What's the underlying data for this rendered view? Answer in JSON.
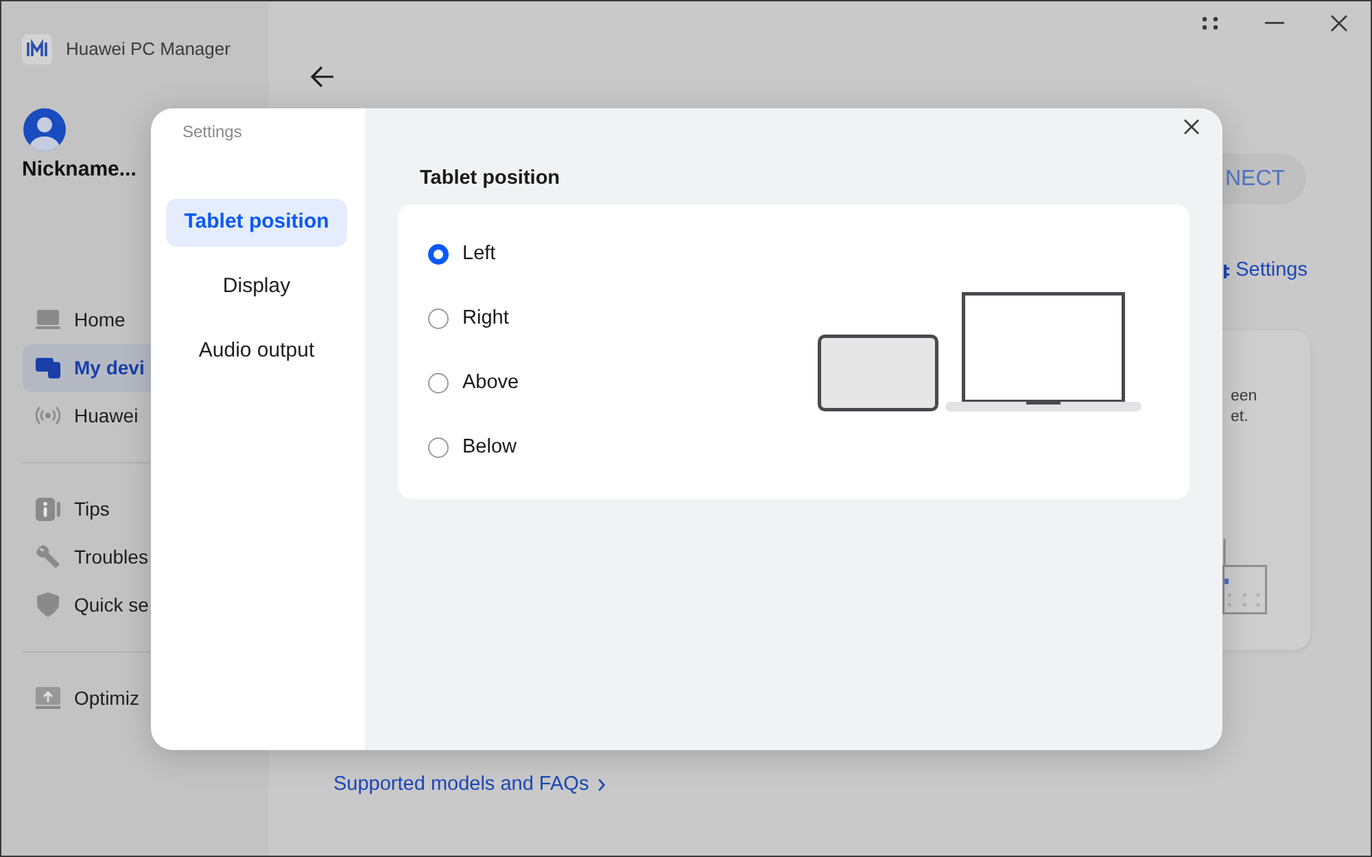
{
  "window": {
    "app_name": "Huawei PC Manager"
  },
  "sidebar": {
    "nickname": "Nickname...",
    "sections": [
      {
        "items": [
          {
            "label": "Home",
            "selected": false
          },
          {
            "label": "My devi",
            "selected": true
          },
          {
            "label": "Huawei",
            "selected": false
          }
        ]
      },
      {
        "items": [
          {
            "label": "Tips",
            "selected": false
          },
          {
            "label": "Troubles",
            "selected": false
          },
          {
            "label": "Quick se",
            "selected": false
          }
        ]
      },
      {
        "items": [
          {
            "label": "Optimiz",
            "selected": false
          }
        ]
      }
    ]
  },
  "main": {
    "connect_button": "NECT",
    "settings_link": "Settings",
    "card_text": [
      "een",
      "et."
    ],
    "footer_link": "Supported models and FAQs"
  },
  "dialog": {
    "title": "Settings",
    "nav": [
      {
        "label": "Tablet position",
        "selected": true
      },
      {
        "label": "Display",
        "selected": false
      },
      {
        "label": "Audio output",
        "selected": false
      }
    ],
    "heading": "Tablet position",
    "options": [
      {
        "label": "Left",
        "selected": true
      },
      {
        "label": "Right",
        "selected": false
      },
      {
        "label": "Above",
        "selected": false
      },
      {
        "label": "Below",
        "selected": false
      }
    ]
  }
}
